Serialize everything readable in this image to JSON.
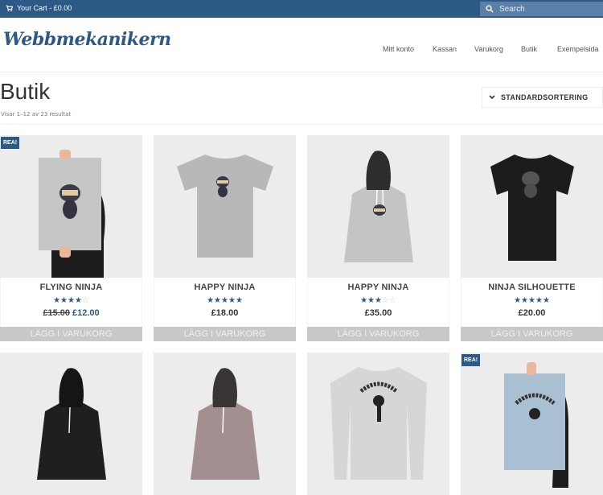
{
  "topbar": {
    "cart_label": "Your Cart - £0.00",
    "search_placeholder": "Search"
  },
  "header": {
    "logo": "Webbmekanikern",
    "nav": [
      "Mitt konto",
      "Kassan",
      "Varukorg",
      "Butik",
      "Exempelsida"
    ]
  },
  "page": {
    "title": "Butik",
    "results_text": "Visar 1–12 av 23 resultat",
    "sort_label": "STANDARDSORTERING"
  },
  "products": [
    {
      "name": "FLYING NINJA",
      "rating": 4,
      "old_price": "£15.00",
      "price": "£12.00",
      "sale": true,
      "badge": "REA!",
      "button": "LÄGG I VARUKORG",
      "image": "poster"
    },
    {
      "name": "HAPPY NINJA",
      "rating": 5,
      "old_price": null,
      "price": "£18.00",
      "sale": false,
      "badge": null,
      "button": "LÄGG I VARUKORG",
      "image": "grey-tshirt"
    },
    {
      "name": "HAPPY NINJA",
      "rating": 3,
      "old_price": null,
      "price": "£35.00",
      "sale": false,
      "badge": null,
      "button": "LÄGG I VARUKORG",
      "image": "grey-hoodie"
    },
    {
      "name": "NINJA SILHOUETTE",
      "rating": 5,
      "old_price": null,
      "price": "£20.00",
      "sale": false,
      "badge": null,
      "button": "LÄGG I VARUKORG",
      "image": "black-tshirt"
    },
    {
      "name": "",
      "rating": null,
      "price": null,
      "sale": false,
      "badge": null,
      "image": "black-hoodie"
    },
    {
      "name": "",
      "rating": null,
      "price": null,
      "sale": false,
      "badge": null,
      "image": "pink-hoodie"
    },
    {
      "name": "",
      "rating": null,
      "price": null,
      "sale": false,
      "badge": null,
      "image": "woo-longsleeve"
    },
    {
      "name": "",
      "rating": null,
      "price": null,
      "sale": true,
      "badge": "REA!",
      "image": "woo-poster"
    }
  ],
  "colors": {
    "brand": "#2c5985",
    "button_bg": "#c8c8c8",
    "card_bg": "#ececec"
  }
}
